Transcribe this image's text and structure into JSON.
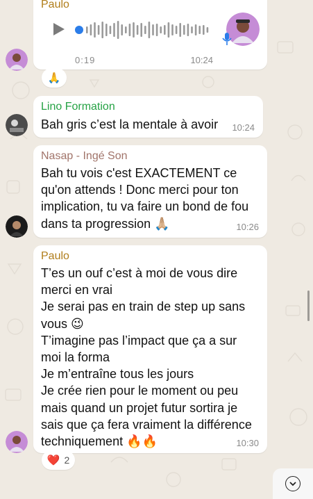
{
  "colors": {
    "paulo": "#b07d1a",
    "lino": "#25a244",
    "nasap": "#a1746a",
    "voice_accent": "#2b7de9"
  },
  "messages": {
    "voice": {
      "sender": "Paulo",
      "duration": "0:19",
      "time": "10:24",
      "progress": 0.0,
      "reaction": "🙏"
    },
    "lino": {
      "sender": "Lino Formation",
      "text": "Bah gris c’est la mentale à avoir",
      "time": "10:24"
    },
    "nasap": {
      "sender": "Nasap - Ingé Son",
      "text": "Bah tu vois c'est EXACTEMENT ce\nqu'on attends ! Donc merci pour ton\nimplication, tu va faire un bond de fou\ndans ta progression 🙏🏼",
      "time": "10:26"
    },
    "paulo": {
      "sender": "Paulo",
      "text": "T’es un ouf c’est à moi de vous dire\nmerci en vrai\nJe serai pas en train de step up sans\nvous 😉\nT’imagine pas l’impact que ça a sur\nmoi la forma\nJe m’entraîne tous les jours\nJe crée rien pour le moment ou peu\nmais quand un projet futur sortira je\nsais que ça fera vraiment la différence\ntechniquement 🔥🔥",
      "time": "10:30",
      "reaction_emoji": "❤️",
      "reaction_count": "2"
    }
  },
  "icons": {
    "play": "play-icon",
    "mic": "microphone-icon",
    "scroll_down": "chevron-down-icon"
  }
}
